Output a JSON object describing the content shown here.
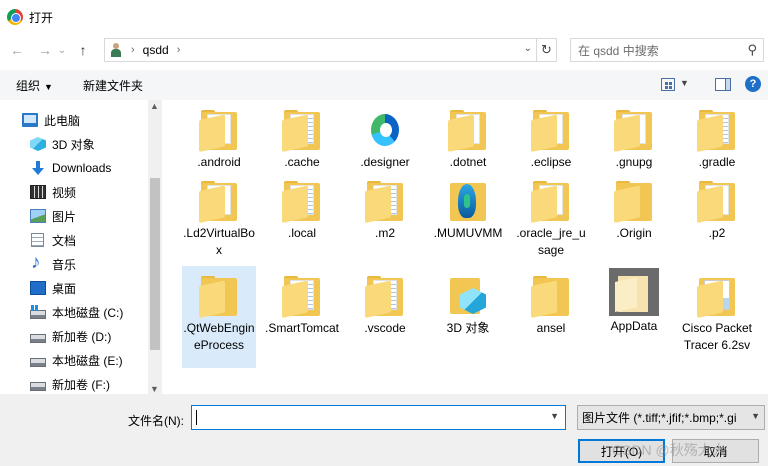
{
  "window": {
    "title": "打开"
  },
  "nav": {
    "back": "←",
    "forward": "→",
    "recent": "⌄",
    "up": "↑",
    "breadcrumb": "qsdd",
    "separator": "›",
    "search_placeholder": "在 qsdd 中搜索"
  },
  "toolbar": {
    "organize": "组织",
    "new_folder": "新建文件夹",
    "help": "?"
  },
  "sidebar": {
    "items": [
      {
        "label": "此电脑",
        "icon": "pc-icon"
      },
      {
        "label": "3D 对象",
        "icon": "cube-3d-icon"
      },
      {
        "label": "Downloads",
        "icon": "download-icon"
      },
      {
        "label": "视频",
        "icon": "video-icon"
      },
      {
        "label": "图片",
        "icon": "picture-icon"
      },
      {
        "label": "文档",
        "icon": "document-icon"
      },
      {
        "label": "音乐",
        "icon": "music-icon"
      },
      {
        "label": "桌面",
        "icon": "desktop-icon"
      },
      {
        "label": "本地磁盘 (C:)",
        "icon": "windows-drive-icon"
      },
      {
        "label": "新加卷 (D:)",
        "icon": "drive-icon"
      },
      {
        "label": "本地磁盘 (E:)",
        "icon": "drive-icon"
      },
      {
        "label": "新加卷 (F:)",
        "icon": "drive-icon"
      }
    ]
  },
  "files": [
    {
      "name": ".android",
      "icon": "folder-icon"
    },
    {
      "name": ".cache",
      "icon": "folder-icon"
    },
    {
      "name": ".designer",
      "icon": "edge-icon"
    },
    {
      "name": ".dotnet",
      "icon": "folder-icon"
    },
    {
      "name": ".eclipse",
      "icon": "folder-icon"
    },
    {
      "name": ".gnupg",
      "icon": "folder-icon"
    },
    {
      "name": ".gradle",
      "icon": "folder-icon"
    },
    {
      "name": ".Ld2VirtualBox",
      "icon": "folder-icon"
    },
    {
      "name": ".local",
      "icon": "folder-icon"
    },
    {
      "name": ".m2",
      "icon": "folder-icon"
    },
    {
      "name": ".MUMUVMM",
      "icon": "mumu-icon"
    },
    {
      "name": ".oracle_jre_usage",
      "icon": "folder-icon"
    },
    {
      "name": ".Origin",
      "icon": "folder-icon"
    },
    {
      "name": ".p2",
      "icon": "folder-icon"
    },
    {
      "name": ".QtWebEngineProcess",
      "icon": "folder-icon"
    },
    {
      "name": ".SmartTomcat",
      "icon": "folder-icon"
    },
    {
      "name": ".vscode",
      "icon": "folder-icon"
    },
    {
      "name": "3D 对象",
      "icon": "cube-3d-icon"
    },
    {
      "name": "ansel",
      "icon": "folder-icon"
    },
    {
      "name": "AppData",
      "icon": "folder-icon"
    },
    {
      "name": "Cisco Packet Tracer 6.2sv",
      "icon": "folder-icon"
    }
  ],
  "footer": {
    "filename_label": "文件名(N):",
    "filename_value": "",
    "filetype": "图片文件 (*.tiff;*.jfif;*.bmp;*.gi",
    "open_button": "打开(O)",
    "cancel_button": "取消",
    "watermark": "CSDN @秋殇大大"
  },
  "colors": {
    "accent": "#0078d7",
    "selection": "#d9ebfa",
    "folder": "#f1c652"
  }
}
